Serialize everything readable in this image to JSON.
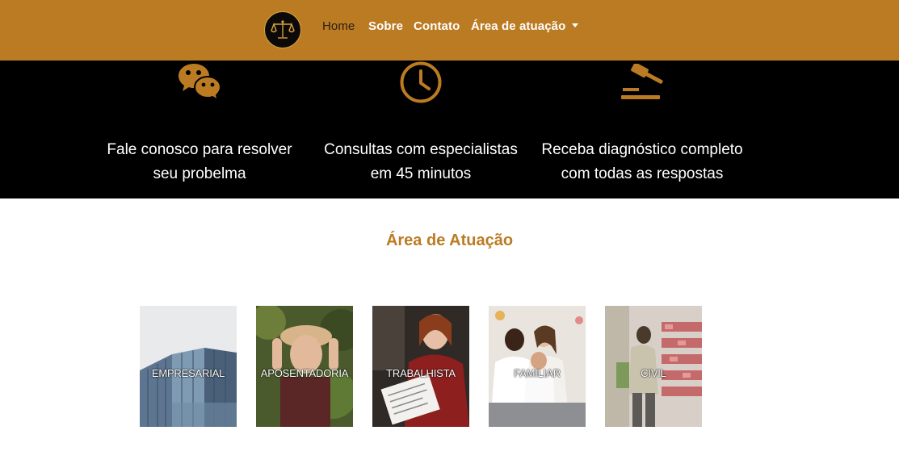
{
  "nav": {
    "logo_icon": "scales-of-justice-icon",
    "items": [
      {
        "label": "Home",
        "active": true
      },
      {
        "label": "Sobre"
      },
      {
        "label": "Contato"
      },
      {
        "label": "Área de atuação",
        "dropdown": true
      }
    ]
  },
  "features": [
    {
      "icon": "chat-bubbles-icon",
      "line1": "Fale conosco para resolver",
      "line2": "seu probelma"
    },
    {
      "icon": "clock-icon",
      "line1": "Consultas com especialistas",
      "line2": "em 45 minutos"
    },
    {
      "icon": "gavel-icon",
      "line1": "Receba diagnóstico completo",
      "line2": "com todas as respostas"
    }
  ],
  "section": {
    "title": "Área de Atuação",
    "cards": [
      {
        "label": "EMPRESARIAL"
      },
      {
        "label": "APOSENTADORIA"
      },
      {
        "label": "TRABALHISTA"
      },
      {
        "label": "FAMILIAR"
      },
      {
        "label": "CIVIL"
      }
    ]
  },
  "colors": {
    "brand": "#bb7b22",
    "dark": "#000000",
    "light": "#ffffff"
  }
}
